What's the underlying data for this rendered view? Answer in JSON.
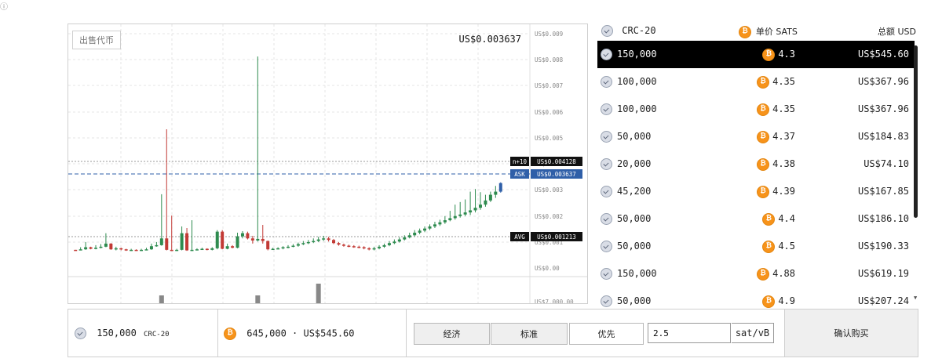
{
  "corner_glyph": "ⓘ",
  "chart": {
    "sell_label": "出售代币",
    "current_price": "US$0.003637",
    "y_ticks": [
      "US$0.009",
      "US$0.008",
      "US$0.007",
      "US$0.006",
      "US$0.005",
      "US$0.004",
      "US$0.003",
      "US$0.002",
      "US$0.001",
      "US$0.00",
      "US$7.000.00"
    ],
    "markers": {
      "n10_tag": "n+10",
      "n10_value": "US$0.004128",
      "ask_tag": "ASK",
      "ask_value": "US$0.003637",
      "avg_tag": "AVG",
      "avg_value": "US$0.001213"
    },
    "colors": {
      "up": "#2e8b4f",
      "down": "#c23a35",
      "ask": "#2f5fa8",
      "volume": "#888888"
    }
  },
  "chart_data": {
    "type": "candlestick",
    "y_axis_label": "",
    "ylim": [
      0,
      0.0095
    ],
    "candles": [
      [
        0.00106,
        0.00104,
        0.00106,
        0.00103
      ],
      [
        0.00104,
        0.00108,
        0.00116,
        0.00104
      ],
      [
        0.00108,
        0.00116,
        0.00136,
        0.00106
      ],
      [
        0.00116,
        0.0011,
        0.00118,
        0.00108
      ],
      [
        0.0011,
        0.00114,
        0.00124,
        0.00108
      ],
      [
        0.00114,
        0.00118,
        0.00128,
        0.00112
      ],
      [
        0.00118,
        0.0013,
        0.0017,
        0.00116
      ],
      [
        0.0013,
        0.00108,
        0.00132,
        0.00106
      ],
      [
        0.00108,
        0.00112,
        0.00118,
        0.00104
      ],
      [
        0.00112,
        0.00108,
        0.00114,
        0.00104
      ],
      [
        0.00108,
        0.00104,
        0.0011,
        0.00102
      ],
      [
        0.00104,
        0.00106,
        0.0011,
        0.00102
      ],
      [
        0.00106,
        0.00104,
        0.00108,
        0.00102
      ],
      [
        0.00104,
        0.00106,
        0.0011,
        0.00102
      ],
      [
        0.00106,
        0.00108,
        0.00114,
        0.00104
      ],
      [
        0.00108,
        0.0012,
        0.0013,
        0.00106
      ],
      [
        0.0012,
        0.00124,
        0.00136,
        0.00118
      ],
      [
        0.00124,
        0.0015,
        0.0032,
        0.00122
      ],
      [
        0.0015,
        0.00106,
        0.0057,
        0.00104
      ],
      [
        0.00106,
        0.00104,
        0.00238,
        0.00102
      ],
      [
        0.00104,
        0.00106,
        0.0011,
        0.00102
      ],
      [
        0.00106,
        0.0017,
        0.00196,
        0.00104
      ],
      [
        0.0017,
        0.00104,
        0.0019,
        0.00102
      ],
      [
        0.00104,
        0.00106,
        0.0022,
        0.00102
      ],
      [
        0.00106,
        0.00108,
        0.00112,
        0.00104
      ],
      [
        0.00108,
        0.0011,
        0.00114,
        0.00106
      ],
      [
        0.0011,
        0.00106,
        0.00112,
        0.00104
      ],
      [
        0.00106,
        0.00112,
        0.00116,
        0.00104
      ],
      [
        0.00112,
        0.00176,
        0.00182,
        0.00108
      ],
      [
        0.00176,
        0.0011,
        0.00182,
        0.00108
      ],
      [
        0.0011,
        0.0012,
        0.0013,
        0.00108
      ],
      [
        0.0012,
        0.00114,
        0.00124,
        0.00112
      ],
      [
        0.00114,
        0.00158,
        0.00172,
        0.00112
      ],
      [
        0.00158,
        0.0017,
        0.00178,
        0.0015
      ],
      [
        0.0017,
        0.0015,
        0.00176,
        0.00146
      ],
      [
        0.0015,
        0.00142,
        0.0016,
        0.0013
      ],
      [
        0.00142,
        0.00148,
        0.0085,
        0.00138
      ],
      [
        0.00148,
        0.0014,
        0.00202,
        0.0013
      ],
      [
        0.0014,
        0.00108,
        0.00142,
        0.00104
      ],
      [
        0.00108,
        0.0011,
        0.00114,
        0.00106
      ],
      [
        0.0011,
        0.00112,
        0.00116,
        0.00108
      ],
      [
        0.00112,
        0.00116,
        0.0012,
        0.00108
      ],
      [
        0.00116,
        0.00118,
        0.00124,
        0.00112
      ],
      [
        0.00118,
        0.00122,
        0.00128,
        0.00116
      ],
      [
        0.00122,
        0.00128,
        0.00134,
        0.00118
      ],
      [
        0.00128,
        0.00132,
        0.0014,
        0.00124
      ],
      [
        0.00132,
        0.00136,
        0.00144,
        0.00128
      ],
      [
        0.00136,
        0.0014,
        0.0015,
        0.00132
      ],
      [
        0.0014,
        0.00146,
        0.00156,
        0.00136
      ],
      [
        0.00146,
        0.0015,
        0.0016,
        0.0014
      ],
      [
        0.0015,
        0.00144,
        0.00156,
        0.00138
      ],
      [
        0.00144,
        0.00132,
        0.00148,
        0.00128
      ],
      [
        0.00132,
        0.00126,
        0.00136,
        0.00122
      ],
      [
        0.00126,
        0.00122,
        0.0013,
        0.00118
      ],
      [
        0.00122,
        0.0012,
        0.00126,
        0.00116
      ],
      [
        0.0012,
        0.00118,
        0.00124,
        0.00114
      ],
      [
        0.00118,
        0.00116,
        0.00122,
        0.00112
      ],
      [
        0.00116,
        0.00112,
        0.0012,
        0.00108
      ],
      [
        0.00112,
        0.00108,
        0.00116,
        0.00104
      ],
      [
        0.00108,
        0.00112,
        0.00118,
        0.00104
      ],
      [
        0.00112,
        0.00118,
        0.00124,
        0.00108
      ],
      [
        0.00118,
        0.00124,
        0.0013,
        0.00114
      ],
      [
        0.00124,
        0.00132,
        0.0014,
        0.0012
      ],
      [
        0.00132,
        0.00138,
        0.00146,
        0.00128
      ],
      [
        0.00138,
        0.00146,
        0.00154,
        0.00134
      ],
      [
        0.00146,
        0.00154,
        0.00162,
        0.00142
      ],
      [
        0.00154,
        0.00162,
        0.00172,
        0.0015
      ],
      [
        0.00162,
        0.00172,
        0.00182,
        0.00158
      ],
      [
        0.00172,
        0.0018,
        0.00188,
        0.00166
      ],
      [
        0.0018,
        0.00188,
        0.00196,
        0.00174
      ],
      [
        0.00188,
        0.00196,
        0.00204,
        0.00182
      ],
      [
        0.00196,
        0.00204,
        0.00214,
        0.0019
      ],
      [
        0.00204,
        0.00212,
        0.00222,
        0.00198
      ],
      [
        0.00212,
        0.0022,
        0.00236,
        0.00206
      ],
      [
        0.0022,
        0.00228,
        0.00256,
        0.00216
      ],
      [
        0.00228,
        0.00236,
        0.0028,
        0.00222
      ],
      [
        0.00236,
        0.00242,
        0.0029,
        0.0023
      ],
      [
        0.00242,
        0.0025,
        0.003,
        0.00236
      ],
      [
        0.0025,
        0.00258,
        0.0033,
        0.0024
      ],
      [
        0.00258,
        0.00268,
        0.0034,
        0.0025
      ],
      [
        0.00268,
        0.0028,
        0.00328,
        0.0026
      ],
      [
        0.0028,
        0.00296,
        0.00318,
        0.00272
      ],
      [
        0.00296,
        0.00318,
        0.0033,
        0.0029
      ],
      [
        0.00318,
        0.0033,
        0.00352,
        0.00306
      ],
      [
        0.0033,
        0.00363,
        0.00366,
        0.00326
      ]
    ],
    "volume": [
      {
        "index": 17,
        "value": 1
      },
      {
        "index": 36,
        "value": 1
      },
      {
        "index": 48,
        "value": 2.5
      }
    ],
    "reference_lines": {
      "n10": 0.004128,
      "ask": 0.003637,
      "avg": 0.001213
    }
  },
  "orderbook": {
    "headers": {
      "qty": "CRC-20",
      "price": "单价 SATS",
      "total": "总额 USD"
    },
    "rows": [
      {
        "qty": "150,000",
        "price": "4.3",
        "total": "US$545.60"
      },
      {
        "qty": "100,000",
        "price": "4.35",
        "total": "US$367.96"
      },
      {
        "qty": "100,000",
        "price": "4.35",
        "total": "US$367.96"
      },
      {
        "qty": "50,000",
        "price": "4.37",
        "total": "US$184.83"
      },
      {
        "qty": "20,000",
        "price": "4.38",
        "total": "US$74.10"
      },
      {
        "qty": "45,200",
        "price": "4.39",
        "total": "US$167.85"
      },
      {
        "qty": "50,000",
        "price": "4.4",
        "total": "US$186.10"
      },
      {
        "qty": "50,000",
        "price": "4.5",
        "total": "US$190.33"
      },
      {
        "qty": "150,000",
        "price": "4.88",
        "total": "US$619.19"
      },
      {
        "qty": "50,000",
        "price": "4.9",
        "total": "US$207.24"
      }
    ],
    "selected_index": 0,
    "coin_btc_glyph": "₿"
  },
  "bottom": {
    "qty_value": "150,000",
    "qty_unit": "CRC-20",
    "cost_text": "645,000 · US$545.60",
    "fee_options": [
      "经济",
      "标准",
      "优先"
    ],
    "fee_active_index": 2,
    "fee_input_value": "2.5",
    "fee_unit": "sat/vB",
    "confirm_label": "确认购买"
  }
}
